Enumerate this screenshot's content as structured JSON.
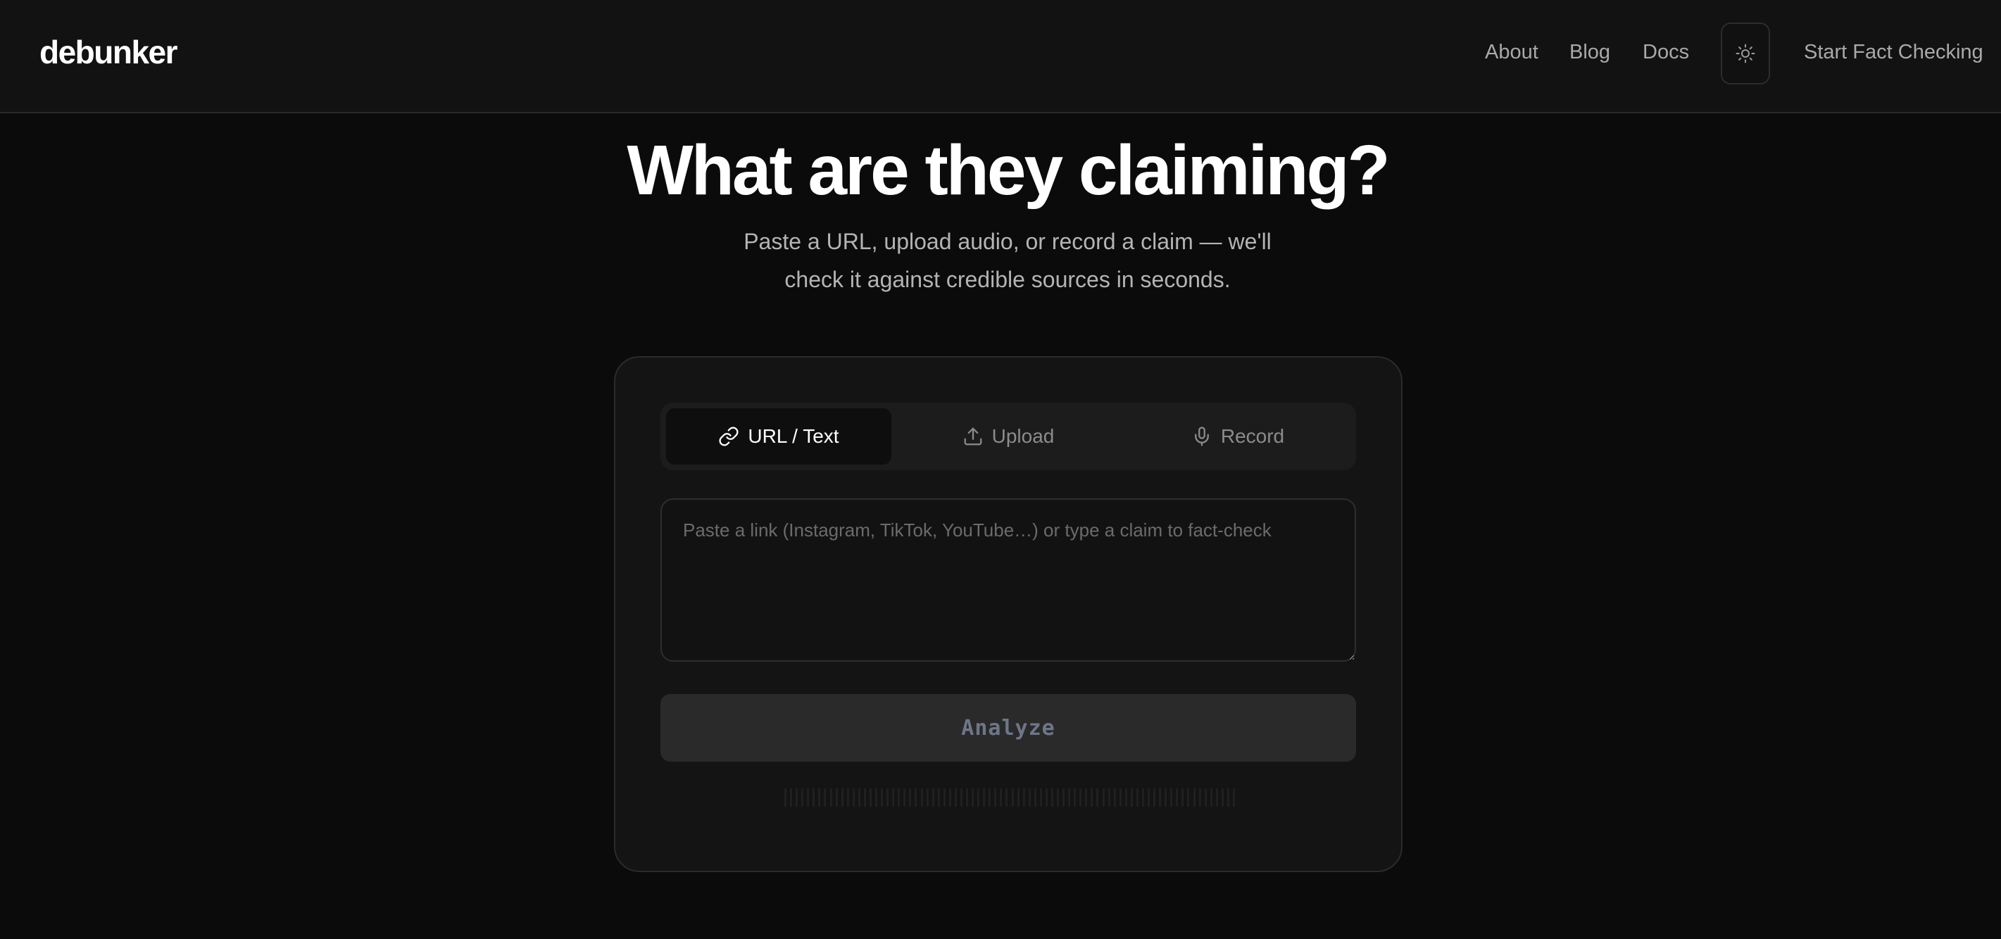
{
  "header": {
    "logo": "debunker",
    "nav": {
      "about": "About",
      "blog": "Blog",
      "docs": "Docs",
      "start": "Start Fact Checking"
    },
    "theme_toggle_icon": "sun-icon"
  },
  "hero": {
    "title": "What are they claiming?",
    "subtitle_line1": "Paste a URL, upload audio, or record a claim — we'll",
    "subtitle_line2": "check it against credible sources in seconds."
  },
  "card": {
    "tabs": [
      {
        "label": "URL / Text",
        "icon": "link-icon",
        "active": true
      },
      {
        "label": "Upload",
        "icon": "upload-icon",
        "active": false
      },
      {
        "label": "Record",
        "icon": "microphone-icon",
        "active": false
      }
    ],
    "input": {
      "placeholder": "Paste a link (Instagram, TikTok, YouTube…) or type a claim to fact-check",
      "value": ""
    },
    "analyze_label": "Analyze"
  },
  "colors": {
    "page_bg": "#0b0b0b",
    "header_bg": "#121212",
    "card_bg": "#141414",
    "active_tab_bg": "#0e0e0e",
    "button_bg": "#2a2a2a",
    "button_text": "#6e7688"
  }
}
